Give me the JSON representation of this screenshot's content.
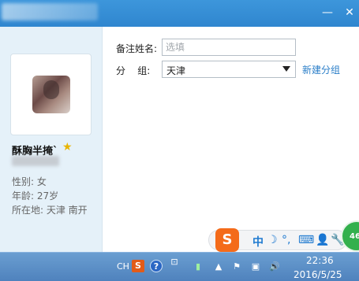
{
  "window": {
    "close_glyph": "✕",
    "minimize_glyph": "—"
  },
  "profile": {
    "nickname": "酥胸半掩`",
    "gender": "性别: 女",
    "age": "年龄: 27岁",
    "location": "所在地: 天津  南开"
  },
  "form": {
    "remark_label": "备注姓名:",
    "remark_placeholder": "选填",
    "remark_value": "",
    "group_label": "分    组:",
    "group_value": "天津",
    "new_group_link": "新建分组"
  },
  "ime": {
    "logo": "S",
    "mode": "中",
    "moon": "☽",
    "punct": "°,",
    "keyboard": "⌨",
    "user": "👤",
    "tools": "🔧",
    "badge": "46"
  },
  "taskbar": {
    "lang": "CH",
    "sogou": "S",
    "help": "?",
    "clock_time": "22:36",
    "clock_date": "2016/5/25"
  },
  "colors": {
    "titlebar": "#2f86cf",
    "link": "#2a7ec8",
    "taskbar": "#4f82bd",
    "ime_orange": "#f46b1a",
    "badge_green": "#33b04d"
  }
}
